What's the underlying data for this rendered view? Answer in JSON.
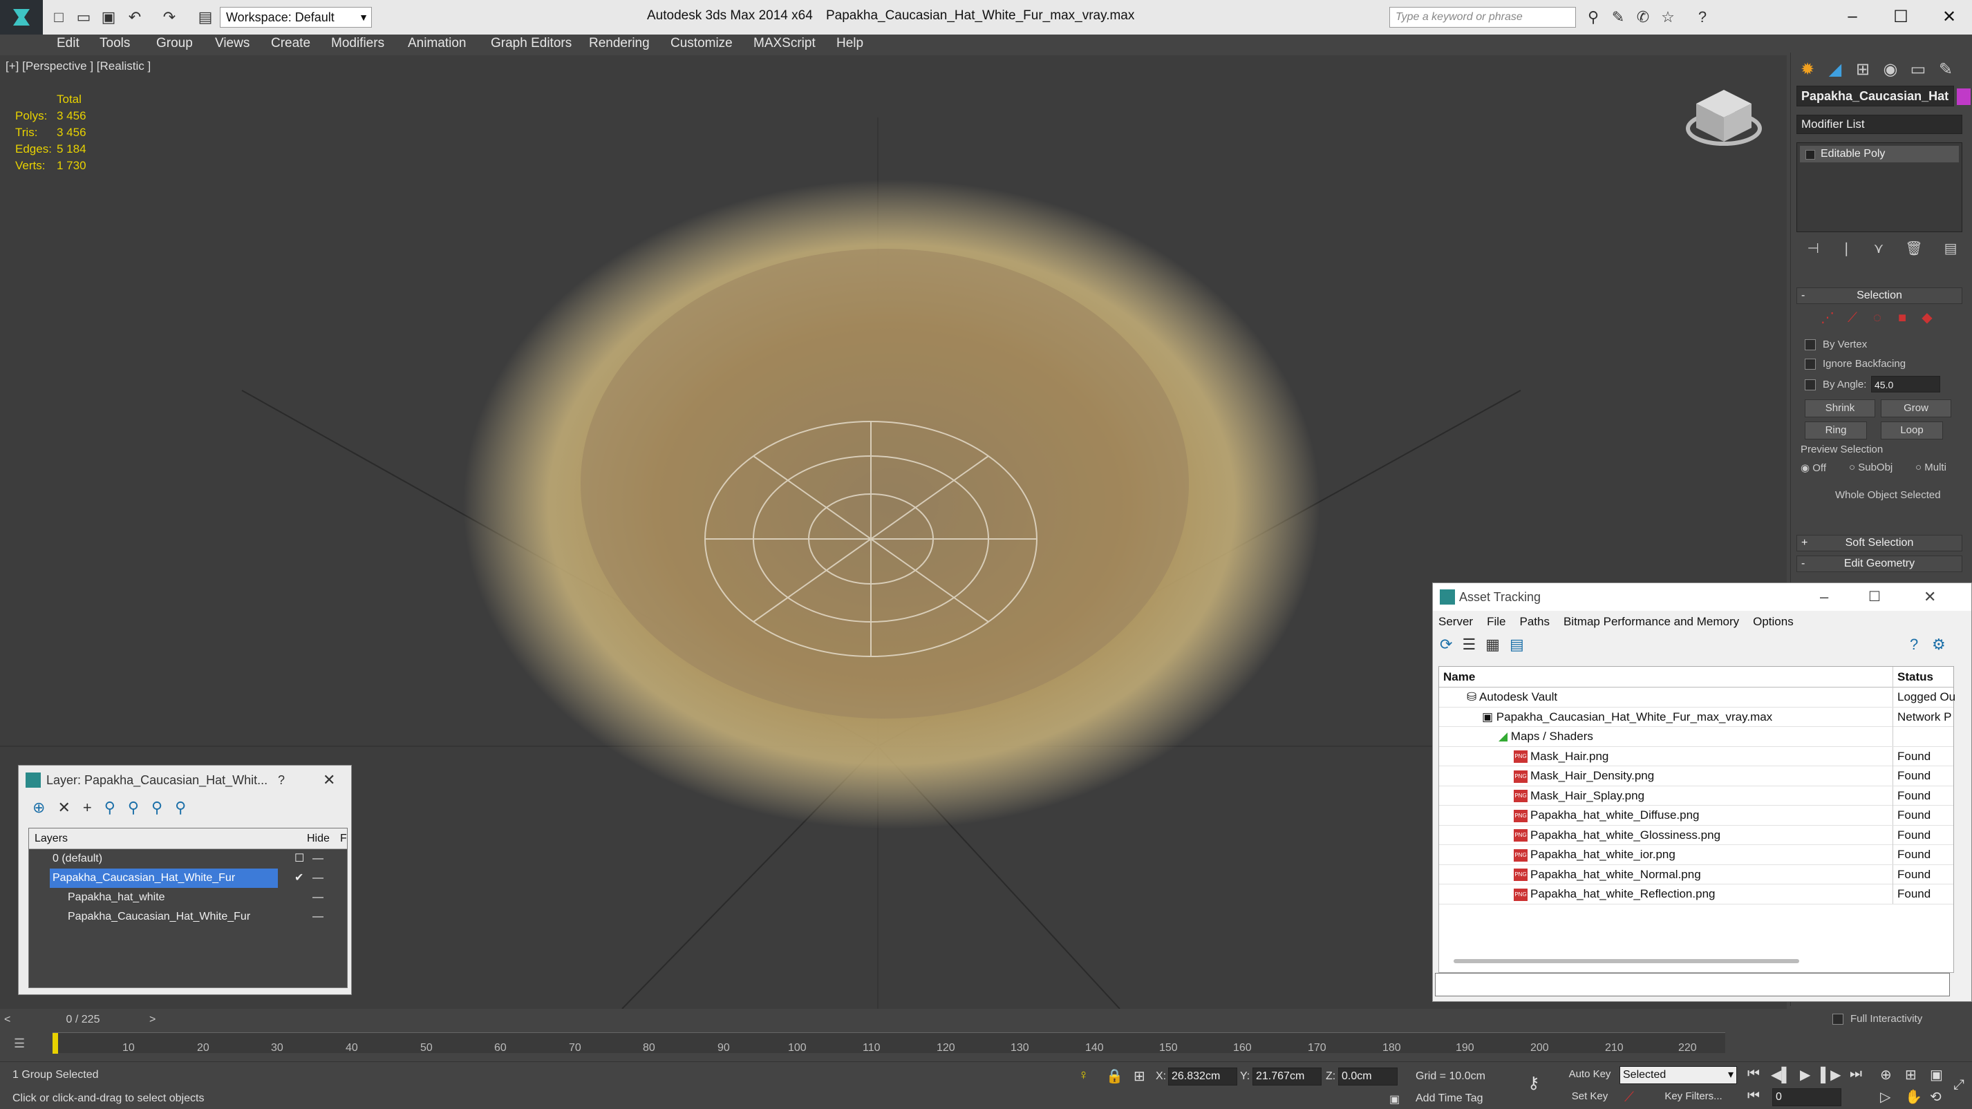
{
  "titlebar": {
    "workspace": "Workspace: Default",
    "app_version": "Autodesk 3ds Max  2014 x64",
    "file_name": "Papakha_Caucasian_Hat_White_Fur_max_vray.max",
    "search_placeholder": "Type a keyword or phrase"
  },
  "menu": [
    "Edit",
    "Tools",
    "Group",
    "Views",
    "Create",
    "Modifiers",
    "Animation",
    "Graph Editors",
    "Rendering",
    "Customize",
    "MAXScript",
    "Help"
  ],
  "viewport": {
    "label": "[+] [Perspective ] [Realistic ]",
    "stats": {
      "total_label": "Total",
      "polys_label": "Polys:",
      "polys": "3 456",
      "tris_label": "Tris:",
      "tris": "3 456",
      "edges_label": "Edges:",
      "edges": "5 184",
      "verts_label": "Verts:",
      "verts": "1 730"
    }
  },
  "command_panel": {
    "object_name": "Papakha_Caucasian_Hat",
    "object_color": "#c03ac8",
    "modifier_list": "Modifier List",
    "modifier_item": "Editable Poly",
    "selection_rollout": "Selection",
    "by_vertex": "By Vertex",
    "ignore_backfacing": "Ignore Backfacing",
    "by_angle": "By Angle:",
    "angle_value": "45.0",
    "shrink": "Shrink",
    "grow": "Grow",
    "ring": "Ring",
    "loop": "Loop",
    "preview_selection": "Preview Selection",
    "off": "Off",
    "subobj": "SubObj",
    "multi": "Multi",
    "whole_object": "Whole Object Selected",
    "soft_selection": "Soft Selection",
    "edit_geometry": "Edit Geometry",
    "full_interactivity": "Full Interactivity"
  },
  "layer_window": {
    "title": "Layer: Papakha_Caucasian_Hat_Whit...",
    "help": "?",
    "col_layers": "Layers",
    "col_hide": "Hide",
    "col_f": "F",
    "rows": [
      {
        "name": "0 (default)"
      },
      {
        "name": "Papakha_Caucasian_Hat_White_Fur"
      },
      {
        "name": "Papakha_hat_white"
      },
      {
        "name": "Papakha_Caucasian_Hat_White_Fur"
      }
    ]
  },
  "asset_window": {
    "title": "Asset Tracking",
    "menu": [
      "Server",
      "File",
      "Paths",
      "Bitmap Performance and Memory",
      "Options"
    ],
    "col_name": "Name",
    "col_status": "Status",
    "rows": [
      {
        "name": "Autodesk Vault",
        "status": "Logged Ou"
      },
      {
        "name": "Papakha_Caucasian_Hat_White_Fur_max_vray.max",
        "status": "Network P"
      },
      {
        "name": "Maps / Shaders",
        "status": ""
      },
      {
        "name": "Mask_Hair.png",
        "status": "Found"
      },
      {
        "name": "Mask_Hair_Density.png",
        "status": "Found"
      },
      {
        "name": "Mask_Hair_Splay.png",
        "status": "Found"
      },
      {
        "name": "Papakha_hat_white_Diffuse.png",
        "status": "Found"
      },
      {
        "name": "Papakha_hat_white_Glossiness.png",
        "status": "Found"
      },
      {
        "name": "Papakha_hat_white_ior.png",
        "status": "Found"
      },
      {
        "name": "Papakha_hat_white_Normal.png",
        "status": "Found"
      },
      {
        "name": "Papakha_hat_white_Reflection.png",
        "status": "Found"
      }
    ]
  },
  "timeline": {
    "frame": "0 / 225",
    "ticks": [
      "10",
      "20",
      "30",
      "40",
      "50",
      "60",
      "70",
      "80",
      "90",
      "100",
      "110",
      "120",
      "130",
      "140",
      "150",
      "160",
      "170",
      "180",
      "190",
      "200",
      "210",
      "220"
    ]
  },
  "status_bar": {
    "selected": "1 Group Selected",
    "prompt": "Click or click-and-drag to select objects",
    "x_label": "X:",
    "x": "26.832cm",
    "y_label": "Y:",
    "y": "21.767cm",
    "z_label": "Z:",
    "z": "0.0cm",
    "grid": "Grid = 10.0cm",
    "add_time_tag": "Add Time Tag",
    "auto_key": "Auto Key",
    "set_key": "Set Key",
    "key_mode": "Selected",
    "key_filters": "Key Filters...",
    "frame_field": "0"
  }
}
